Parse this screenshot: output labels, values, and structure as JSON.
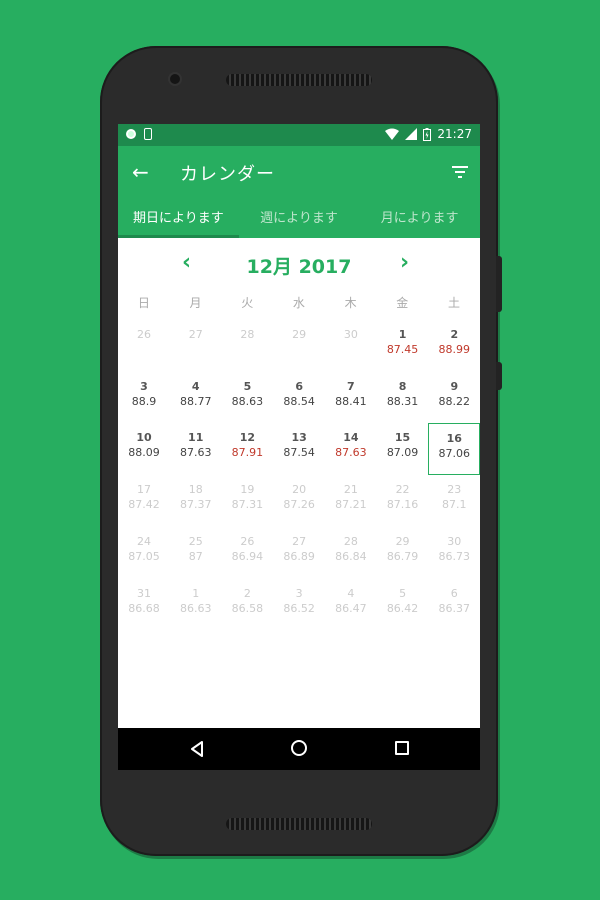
{
  "status": {
    "time": "21:27"
  },
  "appbar": {
    "title": "カレンダー",
    "back_icon": "←"
  },
  "tabs": [
    {
      "label": "期日によります",
      "active": true
    },
    {
      "label": "週によります",
      "active": false
    },
    {
      "label": "月によります",
      "active": false
    }
  ],
  "calendar": {
    "month_label": "12月 2017",
    "prev_icon": "‹",
    "next_icon": "›",
    "weekdays": [
      "日",
      "月",
      "火",
      "水",
      "木",
      "金",
      "土"
    ],
    "selected_day": "16",
    "weeks": [
      [
        {
          "d": "26",
          "v": "",
          "muted": true
        },
        {
          "d": "27",
          "v": "",
          "muted": true
        },
        {
          "d": "28",
          "v": "",
          "muted": true
        },
        {
          "d": "29",
          "v": "",
          "muted": true
        },
        {
          "d": "30",
          "v": "",
          "muted": true
        },
        {
          "d": "1",
          "v": "87.45",
          "red": true
        },
        {
          "d": "2",
          "v": "88.99",
          "red": true
        }
      ],
      [
        {
          "d": "3",
          "v": "88.9"
        },
        {
          "d": "4",
          "v": "88.77"
        },
        {
          "d": "5",
          "v": "88.63"
        },
        {
          "d": "6",
          "v": "88.54"
        },
        {
          "d": "7",
          "v": "88.41"
        },
        {
          "d": "8",
          "v": "88.31"
        },
        {
          "d": "9",
          "v": "88.22"
        }
      ],
      [
        {
          "d": "10",
          "v": "88.09"
        },
        {
          "d": "11",
          "v": "87.63"
        },
        {
          "d": "12",
          "v": "87.91",
          "red": true
        },
        {
          "d": "13",
          "v": "87.54"
        },
        {
          "d": "14",
          "v": "87.63",
          "red": true
        },
        {
          "d": "15",
          "v": "87.09"
        },
        {
          "d": "16",
          "v": "87.06",
          "selected": true
        }
      ],
      [
        {
          "d": "17",
          "v": "87.42",
          "future": true
        },
        {
          "d": "18",
          "v": "87.37",
          "future": true
        },
        {
          "d": "19",
          "v": "87.31",
          "future": true
        },
        {
          "d": "20",
          "v": "87.26",
          "future": true
        },
        {
          "d": "21",
          "v": "87.21",
          "future": true
        },
        {
          "d": "22",
          "v": "87.16",
          "future": true
        },
        {
          "d": "23",
          "v": "87.1",
          "future": true
        }
      ],
      [
        {
          "d": "24",
          "v": "87.05",
          "future": true
        },
        {
          "d": "25",
          "v": "87",
          "future": true
        },
        {
          "d": "26",
          "v": "86.94",
          "future": true
        },
        {
          "d": "27",
          "v": "86.89",
          "future": true
        },
        {
          "d": "28",
          "v": "86.84",
          "future": true
        },
        {
          "d": "29",
          "v": "86.79",
          "future": true
        },
        {
          "d": "30",
          "v": "86.73",
          "future": true
        }
      ],
      [
        {
          "d": "31",
          "v": "86.68",
          "future": true
        },
        {
          "d": "1",
          "v": "86.63",
          "muted": true
        },
        {
          "d": "2",
          "v": "86.58",
          "muted": true
        },
        {
          "d": "3",
          "v": "86.52",
          "muted": true
        },
        {
          "d": "4",
          "v": "86.47",
          "muted": true
        },
        {
          "d": "5",
          "v": "86.42",
          "muted": true
        },
        {
          "d": "6",
          "v": "86.37",
          "muted": true
        }
      ]
    ]
  },
  "colors": {
    "primary": "#27ae60",
    "primary_dark": "#1e8a4d",
    "red": "#c0392b"
  }
}
